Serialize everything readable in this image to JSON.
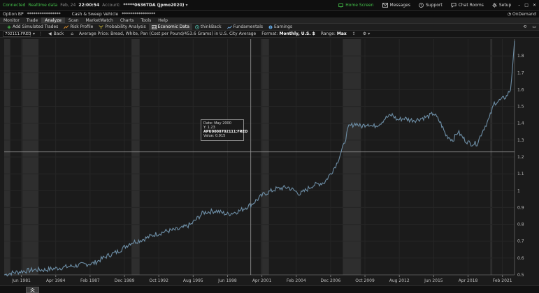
{
  "status": {
    "connection": "Connected",
    "data_mode": "Realtime data",
    "date": "Feb, 24",
    "time": "22:00:54",
    "account_label": "Account:",
    "account_value": "*****0636TDA (jpmo2020)"
  },
  "top_right": {
    "items": [
      {
        "label": "Home Screen",
        "icon": "home-screen-icon",
        "active": true
      },
      {
        "label": "Messages",
        "icon": "envelope-icon"
      },
      {
        "label": "Support",
        "icon": "help-circle-icon"
      },
      {
        "label": "Chat Rooms",
        "icon": "chat-icon"
      },
      {
        "label": "Setup",
        "icon": "gear-icon"
      }
    ]
  },
  "account_bar": {
    "option_bp_label": "Option BP",
    "option_bp_value": "****************",
    "cash_label": "Cash & Sweep Vehicle",
    "cash_value": "****************",
    "ondemand_label": "OnDemand"
  },
  "main_tabs": [
    "Monitor",
    "Trade",
    "Analyze",
    "Scan",
    "MarketWatch",
    "Charts",
    "Tools",
    "Help"
  ],
  "active_main_tab": "Analyze",
  "sub_tabs": [
    {
      "label": "Add Simulated Trades",
      "icon": "plus-icon"
    },
    {
      "label": "Risk Profile",
      "icon": "risk-profile-icon"
    },
    {
      "label": "Probability Analysis",
      "icon": "probability-icon"
    },
    {
      "label": "Economic Data",
      "icon": "economic-data-icon",
      "active": true
    },
    {
      "label": "thinkBack",
      "icon": "clock-icon"
    },
    {
      "label": "Fundamentals",
      "icon": "fundamentals-icon"
    },
    {
      "label": "Earnings",
      "icon": "earnings-icon"
    }
  ],
  "chart_bar": {
    "symbol": "702111:FRED",
    "back_label": "Back",
    "series_title": "Average Price: Bread, White, Pan (Cost per Pound/453.6 Grams) in U.S. City Average",
    "format_label": "Format:",
    "format_value": "Monthly, U.S. $",
    "range_label": "Range:",
    "range_value": "Max"
  },
  "tooltip": {
    "date": "Date:   May 2000",
    "y": "Y:   1.23",
    "series_id": "APU0000702111:FRED",
    "value": "Value: 0.915"
  },
  "colors": {
    "line": "#6d8ea6",
    "recession": "#2e2e2e",
    "grid": "#262626",
    "accent_green": "#44c04a",
    "crosshair": "#9a9a9a"
  },
  "chart_data": {
    "type": "line",
    "title": "Average Price: Bread, White, Pan (Cost per Pound/453.6 Grams) in U.S. City Average",
    "xlabel": "",
    "ylabel": "",
    "x_start": "1980-01",
    "x_end": "2022-02",
    "ylim": [
      0.5,
      1.9
    ],
    "y_ticks": [
      0.5,
      0.6,
      0.7,
      0.8,
      0.9,
      1,
      1.1,
      1.2,
      1.3,
      1.4,
      1.5,
      1.6,
      1.7,
      1.8
    ],
    "x_ticks": [
      {
        "label": "Jun 1981",
        "date": "1981-06"
      },
      {
        "label": "Apr 1984",
        "date": "1984-04"
      },
      {
        "label": "Feb 1987",
        "date": "1987-02"
      },
      {
        "label": "Dec 1989",
        "date": "1989-12"
      },
      {
        "label": "Oct 1992",
        "date": "1992-10"
      },
      {
        "label": "Aug 1995",
        "date": "1995-08"
      },
      {
        "label": "Jun 1998",
        "date": "1998-06"
      },
      {
        "label": "Apr 2001",
        "date": "2001-04"
      },
      {
        "label": "Feb 2004",
        "date": "2004-02"
      },
      {
        "label": "Dec 2006",
        "date": "2006-12"
      },
      {
        "label": "Oct 2009",
        "date": "2009-10"
      },
      {
        "label": "Aug 2012",
        "date": "2012-08"
      },
      {
        "label": "Jun 2015",
        "date": "2015-06"
      },
      {
        "label": "Apr 2018",
        "date": "2018-04"
      },
      {
        "label": "Feb 2021",
        "date": "2021-02"
      }
    ],
    "recessions": [
      {
        "start": "1980-01",
        "end": "1980-07"
      },
      {
        "start": "1981-07",
        "end": "1982-11"
      },
      {
        "start": "1990-07",
        "end": "1991-03"
      },
      {
        "start": "2001-03",
        "end": "2001-11"
      },
      {
        "start": "2007-12",
        "end": "2009-06"
      },
      {
        "start": "2020-02",
        "end": "2020-04"
      }
    ],
    "crosshair": {
      "date": "2000-05",
      "y": 1.23
    },
    "series": [
      {
        "points": [
          [
            "1980-01",
            0.5
          ],
          [
            "1980-07",
            0.51
          ],
          [
            "1981-06",
            0.52
          ],
          [
            "1982-06",
            0.53
          ],
          [
            "1983-06",
            0.53
          ],
          [
            "1984-06",
            0.54
          ],
          [
            "1985-06",
            0.55
          ],
          [
            "1986-06",
            0.56
          ],
          [
            "1987-06",
            0.57
          ],
          [
            "1988-06",
            0.61
          ],
          [
            "1989-06",
            0.64
          ],
          [
            "1990-06",
            0.69
          ],
          [
            "1991-06",
            0.71
          ],
          [
            "1992-06",
            0.74
          ],
          [
            "1993-06",
            0.76
          ],
          [
            "1994-06",
            0.77
          ],
          [
            "1995-06",
            0.8
          ],
          [
            "1996-06",
            0.87
          ],
          [
            "1997-06",
            0.88
          ],
          [
            "1998-06",
            0.86
          ],
          [
            "1999-06",
            0.88
          ],
          [
            "2000-06",
            0.92
          ],
          [
            "2001-06",
            0.98
          ],
          [
            "2002-06",
            1.01
          ],
          [
            "2003-06",
            1.02
          ],
          [
            "2004-06",
            0.98
          ],
          [
            "2005-06",
            1.03
          ],
          [
            "2006-06",
            1.05
          ],
          [
            "2007-01",
            1.11
          ],
          [
            "2007-06",
            1.16
          ],
          [
            "2008-01",
            1.27
          ],
          [
            "2008-06",
            1.38
          ],
          [
            "2009-01",
            1.4
          ],
          [
            "2009-06",
            1.38
          ],
          [
            "2010-01",
            1.4
          ],
          [
            "2010-06",
            1.38
          ],
          [
            "2011-01",
            1.4
          ],
          [
            "2011-06",
            1.43
          ],
          [
            "2012-01",
            1.45
          ],
          [
            "2012-06",
            1.42
          ],
          [
            "2013-01",
            1.43
          ],
          [
            "2013-06",
            1.42
          ],
          [
            "2014-01",
            1.42
          ],
          [
            "2014-06",
            1.43
          ],
          [
            "2015-01",
            1.44
          ],
          [
            "2015-06",
            1.46
          ],
          [
            "2016-01",
            1.4
          ],
          [
            "2016-06",
            1.33
          ],
          [
            "2017-01",
            1.3
          ],
          [
            "2017-06",
            1.35
          ],
          [
            "2018-01",
            1.3
          ],
          [
            "2018-06",
            1.28
          ],
          [
            "2019-01",
            1.28
          ],
          [
            "2019-06",
            1.35
          ],
          [
            "2020-01",
            1.43
          ],
          [
            "2020-06",
            1.52
          ],
          [
            "2021-01",
            1.54
          ],
          [
            "2021-06",
            1.56
          ],
          [
            "2021-10",
            1.6
          ],
          [
            "2022-01",
            1.8
          ],
          [
            "2022-02",
            1.89
          ]
        ]
      }
    ]
  }
}
